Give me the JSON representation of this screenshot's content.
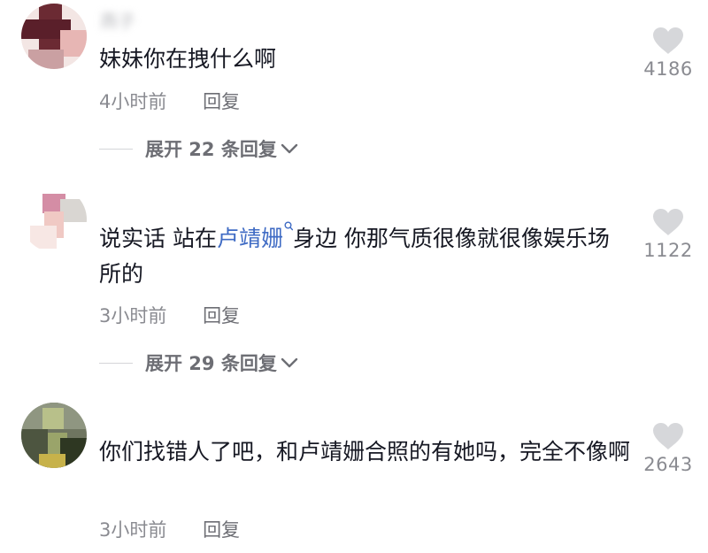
{
  "comments": [
    {
      "username": "燕子",
      "text": "妹妹你在拽什么啊",
      "time": "4小时前",
      "reply_label": "回复",
      "likes": "4186",
      "expand_label": "展开 22 条回复"
    },
    {
      "username": "",
      "text_before": "说实话  站在",
      "mention": "卢靖姗",
      "text_after": "身边  你那气质很像就很像娱乐场所的",
      "time": "3小时前",
      "reply_label": "回复",
      "likes": "1122",
      "expand_label": "展开 29 条回复"
    },
    {
      "username": "",
      "text": "你们找错人了吧，和卢靖姗合照的有她吗，完全不像啊",
      "time": "3小时前",
      "reply_label": "回复",
      "likes": "2643"
    }
  ],
  "colors": {
    "text": "#161823",
    "secondary": "#8a8b91",
    "mention": "#3f6bc4",
    "heart": "#d6d7da"
  },
  "icons": {
    "like": "heart-icon",
    "expand": "chevron-down-icon",
    "mention": "search-icon"
  }
}
